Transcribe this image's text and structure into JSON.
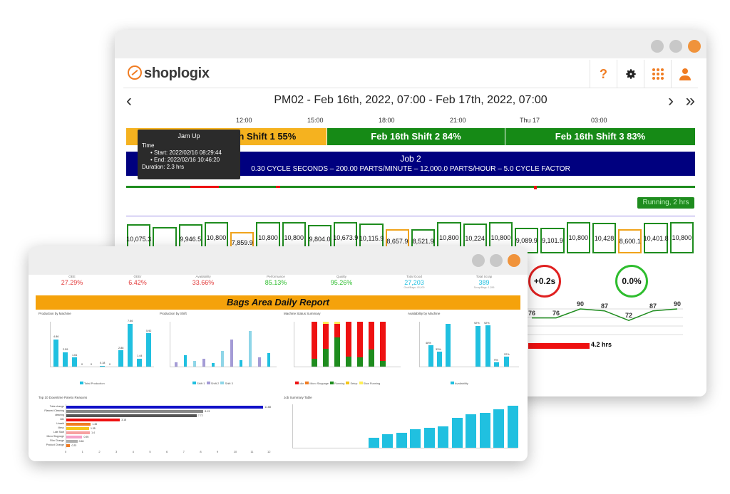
{
  "back": {
    "logo": "shoplogix",
    "header_icons": [
      "help-icon",
      "gear-icon",
      "apps-grid-icon",
      "user-icon"
    ],
    "help_label": "?",
    "nav_title": "PM02 - Feb 16th, 2022, 07:00 - Feb 17th, 2022, 07:00",
    "prev_arrow": "‹",
    "next_arrow": "›",
    "last_arrow": "»",
    "time_ticks": [
      "12:00",
      "15:00",
      "18:00",
      "21:00",
      "Thu 17",
      "03:00"
    ],
    "shifts": [
      {
        "label": "Jam Up",
        "suffix": "16th Shift 1 55%",
        "color": "#f5b21f"
      },
      {
        "label": "Feb 16th Shift 2 84%",
        "color": "#168a16"
      },
      {
        "label": "Feb 16th Shift 3 83%",
        "color": "#168a16"
      }
    ],
    "job": {
      "title": "Job 2",
      "details": "0.30 CYCLE SECONDS  –  200.00 PARTS/MINUTE  –  12,000.0 PARTS/HOUR  –  5.0 CYCLE FACTOR"
    },
    "tooltip": {
      "header": "Jam Up",
      "time_label": "Time",
      "start": "•  Start: 2022/02/16 08:29:44",
      "end": "•  End: 2022/02/16 10:46:20",
      "duration": "Duration: 2.3 hrs"
    },
    "running_badge": "Running, 2 hrs",
    "production_boxes": [
      {
        "label": "10,075.3",
        "fill": 0.78,
        "color": "green"
      },
      {
        "label": "",
        "fill": 0.72,
        "color": "green"
      },
      {
        "label": "9,946.5",
        "fill": 0.78,
        "color": "green"
      },
      {
        "label": "10,800",
        "fill": 0.85,
        "color": "green"
      },
      {
        "label": "7,859.9",
        "fill": 0.58,
        "color": "orange"
      },
      {
        "label": "10,800",
        "fill": 0.85,
        "color": "green"
      },
      {
        "label": "10,800",
        "fill": 0.85,
        "color": "green"
      },
      {
        "label": "9,804.0",
        "fill": 0.76,
        "color": "green"
      },
      {
        "label": "10,673.9",
        "fill": 0.84,
        "color": "green"
      },
      {
        "label": "10,115.9",
        "fill": 0.8,
        "color": "green"
      },
      {
        "label": "8,657.9",
        "fill": 0.66,
        "color": "orange"
      },
      {
        "label": "8,521.9",
        "fill": 0.66,
        "color": "green"
      },
      {
        "label": "10,800",
        "fill": 0.85,
        "color": "green"
      },
      {
        "label": "10,224",
        "fill": 0.8,
        "color": "green"
      },
      {
        "label": "10,800",
        "fill": 0.85,
        "color": "green"
      },
      {
        "label": "9,089.9",
        "fill": 0.7,
        "color": "green"
      },
      {
        "label": "9,101.9",
        "fill": 0.7,
        "color": "green"
      },
      {
        "label": "10,800",
        "fill": 0.85,
        "color": "green"
      },
      {
        "label": "10,428",
        "fill": 0.82,
        "color": "green"
      },
      {
        "label": "8,600.1",
        "fill": 0.66,
        "color": "orange"
      },
      {
        "label": "10,401.8",
        "fill": 0.82,
        "color": "green"
      },
      {
        "label": "10,800",
        "fill": 0.85,
        "color": "green"
      }
    ],
    "circle_values": [
      {
        "label": "+0.2s",
        "color": "#e02020"
      },
      {
        "label": "0.0%",
        "color": "#2ebd2e"
      }
    ],
    "trend_values": [
      76,
      76,
      90,
      87,
      72,
      87,
      90
    ],
    "red_bar_label": "4.2  hrs"
  },
  "front": {
    "kpis": [
      {
        "label": "OEE",
        "value": "27.29%",
        "color": "#e23b3b"
      },
      {
        "label": "OEEr",
        "value": "6.42%",
        "color": "#e23b3b"
      },
      {
        "label": "Availability",
        "value": "33.66%",
        "color": "#e23b3b"
      },
      {
        "label": "Performance",
        "value": "85.13%",
        "color": "#2ebd2e"
      },
      {
        "label": "Quality",
        "value": "95.26%",
        "color": "#2ebd2e"
      },
      {
        "label": "Total Good",
        "value": "27,203",
        "color": "#20c0e0",
        "sub": "Goal/Bags: 40,000"
      },
      {
        "label": "Total Scrap",
        "value": "389",
        "color": "#20c0e0",
        "sub": "Scrap/Bags: 1,356"
      }
    ],
    "report_title": "Bags Area Daily Report",
    "panel_titles": {
      "p1": "Production by Machine",
      "p2": "Production by Shift",
      "p3": "Machine Status Summary",
      "p4": "Availability by Machine",
      "p5": "Top 10 Downtime Pareto Reasons",
      "p6": "Job Summary Table"
    },
    "legends": {
      "p1": "Total Production",
      "p2": [
        "Shift 1",
        "Shift 2",
        "Shift 3"
      ],
      "p3": [
        "Idle",
        "Micro Stoppage",
        "Running",
        "Setup",
        "Slow Running"
      ],
      "p4": "Availability"
    },
    "p1_values": [
      4.86,
      2.59,
      1.61,
      0,
      0,
      0.18,
      0,
      2.88,
      7.66,
      1.44,
      5.92
    ],
    "p1_labels": [
      "4.86",
      "2.59",
      "1.61",
      "0",
      "0",
      "0.18",
      "0",
      "2.88",
      "7.66",
      "1.44",
      "5.92"
    ],
    "p3_stacks": [
      [
        0.82,
        0.12,
        0.06,
        0
      ],
      [
        0.55,
        0.25,
        0.15,
        0.05
      ],
      [
        0.3,
        0.55,
        0.1,
        0.05
      ],
      [
        0.78,
        0.15,
        0.07,
        0
      ],
      [
        0.8,
        0.14,
        0.06,
        0
      ],
      [
        0.62,
        0.28,
        0.1,
        0
      ],
      [
        0.88,
        0.08,
        0.04,
        0
      ]
    ],
    "p4_labels": [
      "48%",
      "33%",
      "92%",
      "92%",
      "9%",
      "22%"
    ],
    "pareto_labels": [
      "Tube change",
      "Planned Cleaning",
      "cleaning",
      "Idle",
      "Unsaid",
      "Meso",
      "Late Start",
      "Micro Stoppage",
      "Film Change",
      "Product Change"
    ],
    "pareto_values": [
      11.68,
      8.13,
      7.72,
      3.18,
      1.45,
      1.35,
      1.4,
      0.95,
      0.66,
      0.23
    ],
    "pareto_value_labels": [
      "11.68",
      "8.13",
      "7.72",
      "3.18",
      "1.45",
      "1.35",
      "1.4",
      "0.95",
      "0.66",
      "0.23"
    ],
    "pareto_axis": [
      "0",
      "1",
      "2",
      "3",
      "4",
      "5",
      "6",
      "7",
      "8",
      "9",
      "10",
      "11",
      "12"
    ],
    "job_values": [
      0,
      0,
      0,
      0,
      0,
      3,
      4,
      4.5,
      5.5,
      6,
      6.5,
      9,
      10,
      10.5,
      11.5,
      12.5
    ]
  },
  "colors": {
    "green": "#1e8c1e",
    "orange": "#f0a31b",
    "cyan": "#20c0e0",
    "navy": "#00007f",
    "accent": "#f07c22"
  }
}
